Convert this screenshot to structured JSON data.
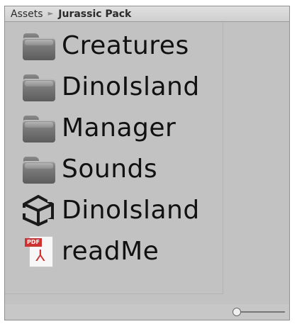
{
  "breadcrumb": {
    "root": "Assets",
    "separator": "►",
    "current": "Jurassic Pack"
  },
  "items": [
    {
      "label": "Creatures",
      "icon": "folder-icon"
    },
    {
      "label": "DinoIsland",
      "icon": "folder-icon"
    },
    {
      "label": "Manager",
      "icon": "folder-icon"
    },
    {
      "label": "Sounds",
      "icon": "folder-icon"
    },
    {
      "label": "DinoIsland",
      "icon": "unity-scene-icon"
    },
    {
      "label": "readMe",
      "icon": "pdf-icon",
      "badge": "PDF"
    }
  ],
  "footer": {
    "zoom_slider_level": 0
  },
  "colors": {
    "panel_bg": "#c2c2c2",
    "pdf_red": "#d32f2f"
  }
}
